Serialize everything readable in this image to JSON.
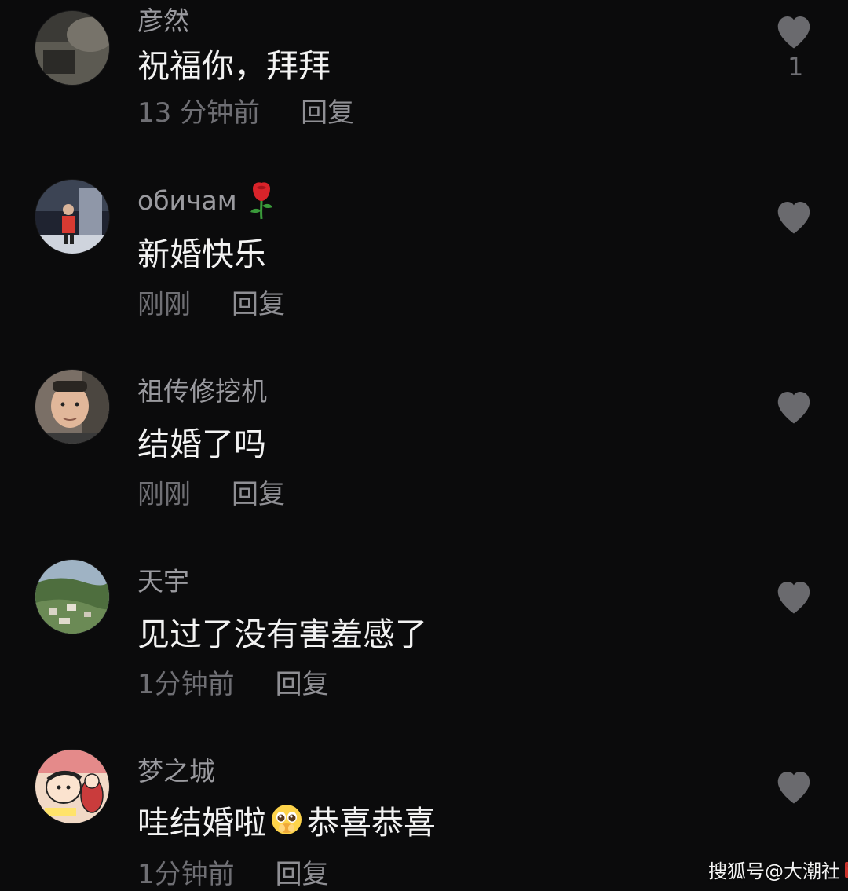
{
  "comments": [
    {
      "username": "彦然",
      "text": "祝福你，拜拜",
      "time": "13 分钟前",
      "reply": "回复",
      "like_count": "1"
    },
    {
      "username": "обичам",
      "username_emoji": "rose-icon",
      "text": "新婚快乐",
      "time": "刚刚",
      "reply": "回复"
    },
    {
      "username": "祖传修挖机",
      "text": "结婚了吗",
      "time": "刚刚",
      "reply": "回复"
    },
    {
      "username": "天宇",
      "text": "见过了没有害羞感了",
      "time": "1分钟前",
      "reply": "回复"
    },
    {
      "username": "梦之城",
      "text_before": "哇结婚啦",
      "text_emoji": "pleading-face-icon",
      "text_after": "恭喜恭喜",
      "time": "1分钟前",
      "reply": "回复"
    }
  ],
  "watermark": {
    "text": "搜狐号@大潮社",
    "badge": "TV"
  },
  "colors": {
    "background": "#0b0b0c",
    "username": "#9a9a9f",
    "text": "#f2f2f2",
    "meta": "#6f6f74",
    "like": "#6a6a6e"
  }
}
